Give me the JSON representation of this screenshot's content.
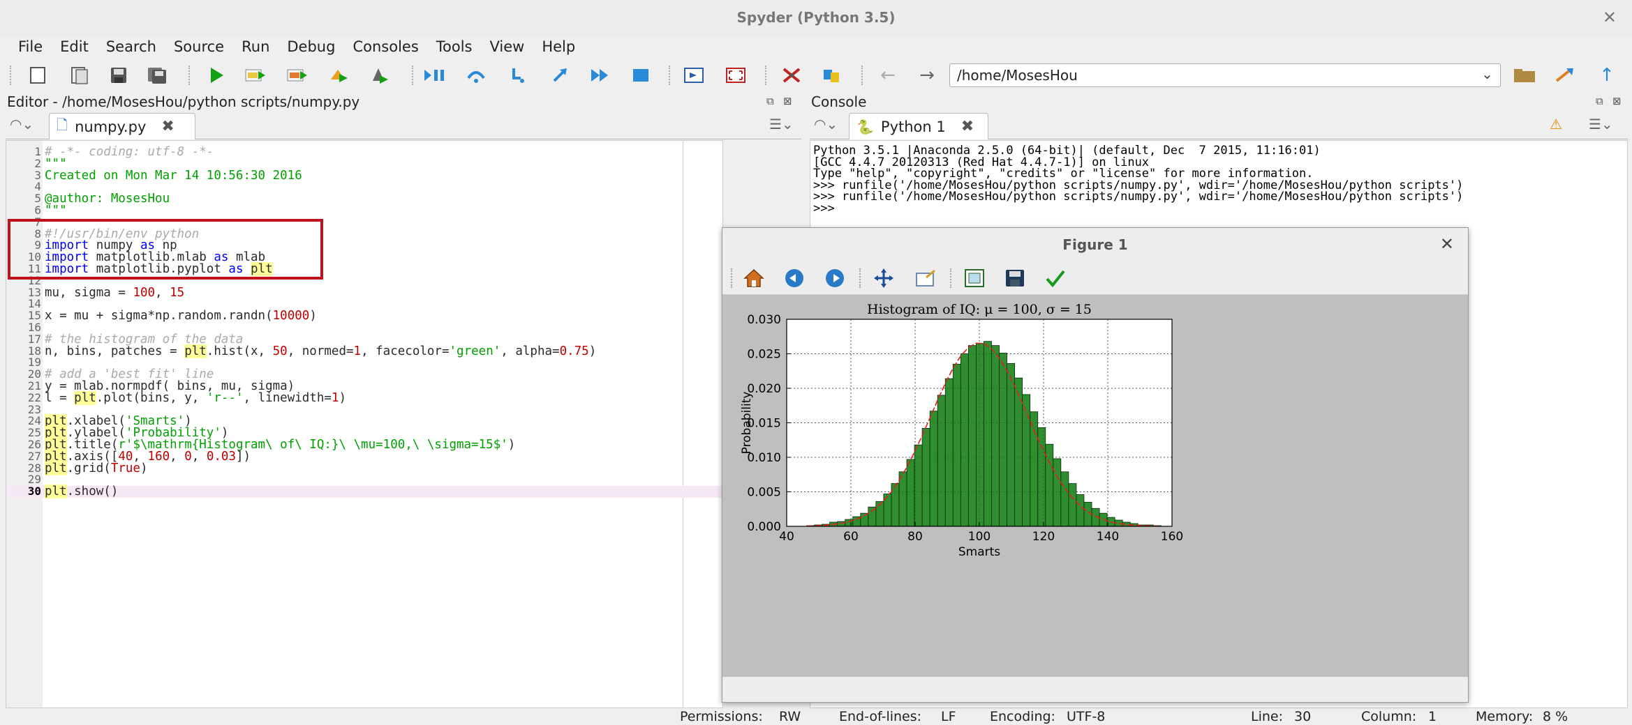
{
  "window": {
    "title": "Spyder (Python 3.5)",
    "close": "✕"
  },
  "menu": [
    "File",
    "Edit",
    "Search",
    "Source",
    "Run",
    "Debug",
    "Consoles",
    "Tools",
    "View",
    "Help"
  ],
  "toolbar": {
    "path": "/home/MosesHou"
  },
  "editor": {
    "title": "Editor - /home/MosesHou/python scripts/numpy.py",
    "tab": "numpy.py",
    "current_line": 30
  },
  "console": {
    "title": "Console",
    "tab": "Python 1",
    "lines": [
      "Python 3.5.1 |Anaconda 2.5.0 (64-bit)| (default, Dec  7 2015, 11:16:01)",
      "[GCC 4.4.7 20120313 (Red Hat 4.4.7-1)] on linux",
      "Type \"help\", \"copyright\", \"credits\" or \"license\" for more information.",
      ">>> runfile('/home/MosesHou/python scripts/numpy.py', wdir='/home/MosesHou/python scripts')",
      ">>> runfile('/home/MosesHou/python scripts/numpy.py', wdir='/home/MosesHou/python scripts')",
      ">>>"
    ]
  },
  "statusbar": {
    "permissions_label": "Permissions:",
    "permissions": "RW",
    "eol_label": "End-of-lines:",
    "eol": "LF",
    "encoding_label": "Encoding:",
    "encoding": "UTF-8",
    "line_label": "Line:",
    "line": "30",
    "column_label": "Column:",
    "column": "1",
    "memory_label": "Memory:",
    "memory": "8 %"
  },
  "figure": {
    "title": "Figure 1",
    "close": "✕"
  },
  "colors": {
    "bar": "#0a7a0a",
    "fit_line": "#e02020",
    "plot_bg": "#ffffff",
    "canvas_bg": "#bfbfbf",
    "code_string": "#00a000",
    "code_keyword": "#0000ff",
    "code_number": "#c00000",
    "highlight_box": "#c0121d"
  },
  "chart_data": {
    "type": "bar",
    "title": "Histogram of IQ: μ = 100, σ = 15",
    "xlabel": "Smarts",
    "ylabel": "Probability",
    "xlim": [
      40,
      160
    ],
    "ylim": [
      0,
      0.03
    ],
    "xticks": [
      "40",
      "60",
      "80",
      "100",
      "120",
      "140",
      "160"
    ],
    "yticks": [
      "0.000",
      "0.005",
      "0.010",
      "0.015",
      "0.020",
      "0.025",
      "0.030"
    ],
    "grid": true,
    "bins": [
      46.2,
      48.6,
      51.0,
      53.4,
      55.8,
      58.2,
      60.6,
      63.0,
      65.4,
      67.8,
      70.2,
      72.6,
      75.0,
      77.4,
      79.8,
      82.2,
      84.6,
      87.0,
      89.4,
      91.8,
      94.2,
      96.6,
      99.0,
      101.4,
      103.8,
      106.2,
      108.6,
      111.0,
      113.4,
      115.8,
      118.2,
      120.6,
      123.0,
      125.4,
      127.8,
      130.2,
      132.6,
      135.0,
      137.4,
      139.8,
      142.2,
      144.6,
      147.0,
      149.4,
      151.8,
      154.2,
      156.6
    ],
    "values": [
      0.0001,
      0.0002,
      0.0003,
      0.0006,
      0.0007,
      0.001,
      0.0014,
      0.0019,
      0.0028,
      0.0036,
      0.0047,
      0.0062,
      0.0079,
      0.0097,
      0.0118,
      0.0142,
      0.0167,
      0.019,
      0.0214,
      0.0235,
      0.025,
      0.0262,
      0.0265,
      0.0268,
      0.0262,
      0.0251,
      0.0236,
      0.0215,
      0.0191,
      0.0166,
      0.0143,
      0.0119,
      0.0098,
      0.0079,
      0.0062,
      0.0046,
      0.0035,
      0.0026,
      0.0019,
      0.0013,
      0.0009,
      0.0006,
      0.0004,
      0.0002,
      0.0002,
      0.0001
    ],
    "fit_line": {
      "type": "line",
      "style": "r--",
      "mu": 100,
      "sigma": 15
    }
  }
}
